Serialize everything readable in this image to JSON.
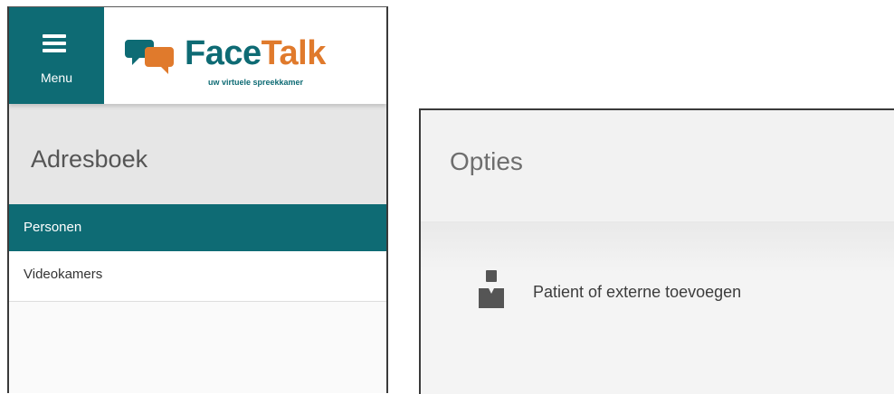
{
  "header": {
    "menu_label": "Menu",
    "logo_word_face": "Face",
    "logo_word_talk": "Talk",
    "logo_tagline": "uw virtuele spreekkamer",
    "brand_color": "#0e6b74",
    "accent_color": "#e07a2c"
  },
  "left": {
    "title": "Adresboek",
    "nav_items": [
      {
        "label": "Personen",
        "active": true
      },
      {
        "label": "Videokamers",
        "active": false
      }
    ]
  },
  "right": {
    "title": "Opties",
    "options": [
      {
        "label": "Patient of externe toevoegen",
        "icon": "person-icon"
      }
    ]
  }
}
